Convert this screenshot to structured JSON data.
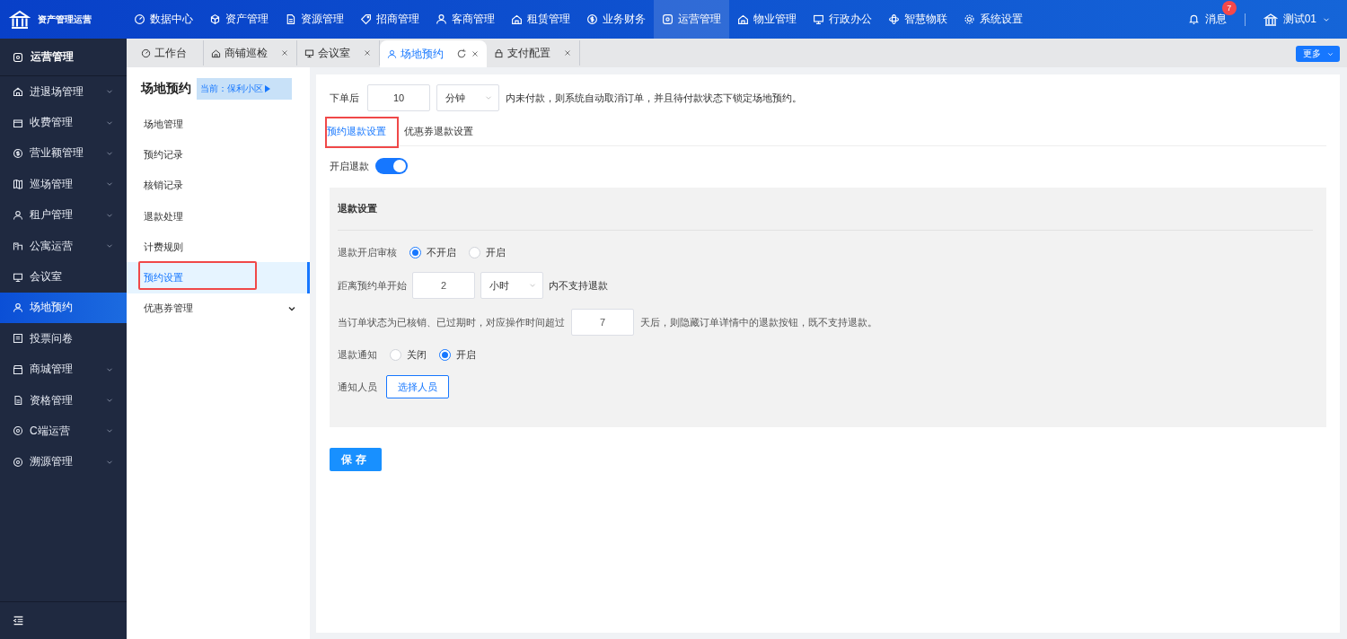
{
  "app": {
    "title": "资产管理运营"
  },
  "top_nav": [
    {
      "label": "数据中心",
      "selected": false
    },
    {
      "label": "资产管理",
      "selected": false
    },
    {
      "label": "资源管理",
      "selected": false
    },
    {
      "label": "招商管理",
      "selected": false
    },
    {
      "label": "客商管理",
      "selected": false
    },
    {
      "label": "租赁管理",
      "selected": false
    },
    {
      "label": "业务财务",
      "selected": false
    },
    {
      "label": "运营管理",
      "selected": true
    },
    {
      "label": "物业管理",
      "selected": false
    },
    {
      "label": "行政办公",
      "selected": false
    },
    {
      "label": "智慧物联",
      "selected": false
    },
    {
      "label": "系统设置",
      "selected": false
    }
  ],
  "notifications": {
    "label": "消息",
    "badge": "7"
  },
  "user": {
    "name": "测试01"
  },
  "sidebar": {
    "title": "运营管理",
    "items": [
      {
        "label": "进退场管理",
        "expandable": true,
        "selected": false
      },
      {
        "label": "收费管理",
        "expandable": true,
        "selected": false
      },
      {
        "label": "营业额管理",
        "expandable": true,
        "selected": false
      },
      {
        "label": "巡场管理",
        "expandable": true,
        "selected": false
      },
      {
        "label": "租户管理",
        "expandable": true,
        "selected": false
      },
      {
        "label": "公寓运营",
        "expandable": true,
        "selected": false
      },
      {
        "label": "会议室",
        "expandable": false,
        "selected": false
      },
      {
        "label": "场地预约",
        "expandable": false,
        "selected": true
      },
      {
        "label": "投票问卷",
        "expandable": false,
        "selected": false
      },
      {
        "label": "商城管理",
        "expandable": true,
        "selected": false
      },
      {
        "label": "资格管理",
        "expandable": true,
        "selected": false
      },
      {
        "label": "C端运营",
        "expandable": true,
        "selected": false
      },
      {
        "label": "溯源管理",
        "expandable": true,
        "selected": false
      }
    ]
  },
  "tabs": [
    {
      "label": "工作台",
      "closable": false,
      "selected": false
    },
    {
      "label": "商铺巡检",
      "closable": true,
      "selected": false
    },
    {
      "label": "会议室",
      "closable": true,
      "selected": false
    },
    {
      "label": "场地预约",
      "closable": true,
      "selected": true
    },
    {
      "label": "支付配置",
      "closable": true,
      "selected": false
    }
  ],
  "more_button": {
    "label": "更多"
  },
  "subnav": {
    "title": "场地预约",
    "scope": "当前：保利小区",
    "items": [
      {
        "label": "场地管理",
        "expandable": false,
        "selected": false,
        "highlighted": false
      },
      {
        "label": "预约记录",
        "expandable": false,
        "selected": false,
        "highlighted": false
      },
      {
        "label": "核销记录",
        "expandable": false,
        "selected": false,
        "highlighted": false
      },
      {
        "label": "退款处理",
        "expandable": false,
        "selected": false,
        "highlighted": false
      },
      {
        "label": "计费规则",
        "expandable": false,
        "selected": false,
        "highlighted": false
      },
      {
        "label": "预约设置",
        "expandable": false,
        "selected": true,
        "highlighted": true
      },
      {
        "label": "优惠券管理",
        "expandable": true,
        "selected": false,
        "highlighted": false
      }
    ]
  },
  "order_timeout": {
    "prefix": "下单后",
    "value": "10",
    "unit": "分钟",
    "suffix": "内未付款，则系统自动取消订单，并且待付款状态下锁定场地预约。"
  },
  "refund_tabs": [
    {
      "label": "预约退款设置",
      "selected": true,
      "highlighted": true
    },
    {
      "label": "优惠券退款设置",
      "selected": false,
      "highlighted": false
    }
  ],
  "refund_toggle": {
    "label": "开启退款",
    "on": true
  },
  "refund_settings": {
    "title": "退款设置",
    "review": {
      "label": "退款开启审核",
      "options": [
        {
          "label": "不开启",
          "selected": true
        },
        {
          "label": "开启",
          "selected": false
        }
      ]
    },
    "cutoff": {
      "prefix": "距离预约单开始",
      "value": "2",
      "unit": "小时",
      "suffix": "内不支持退款"
    },
    "hide_after": {
      "prefix": "当订单状态为已核销、已过期时，对应操作时间超过",
      "value": "7",
      "suffix": "天后，则隐藏订单详情中的退款按钮，既不支持退款。"
    },
    "notify": {
      "label": "退款通知",
      "options": [
        {
          "label": "关闭",
          "selected": false
        },
        {
          "label": "开启",
          "selected": true
        }
      ]
    },
    "recipients": {
      "label": "通知人员",
      "button": "选择人员"
    }
  },
  "save_button": {
    "label": "保存"
  }
}
